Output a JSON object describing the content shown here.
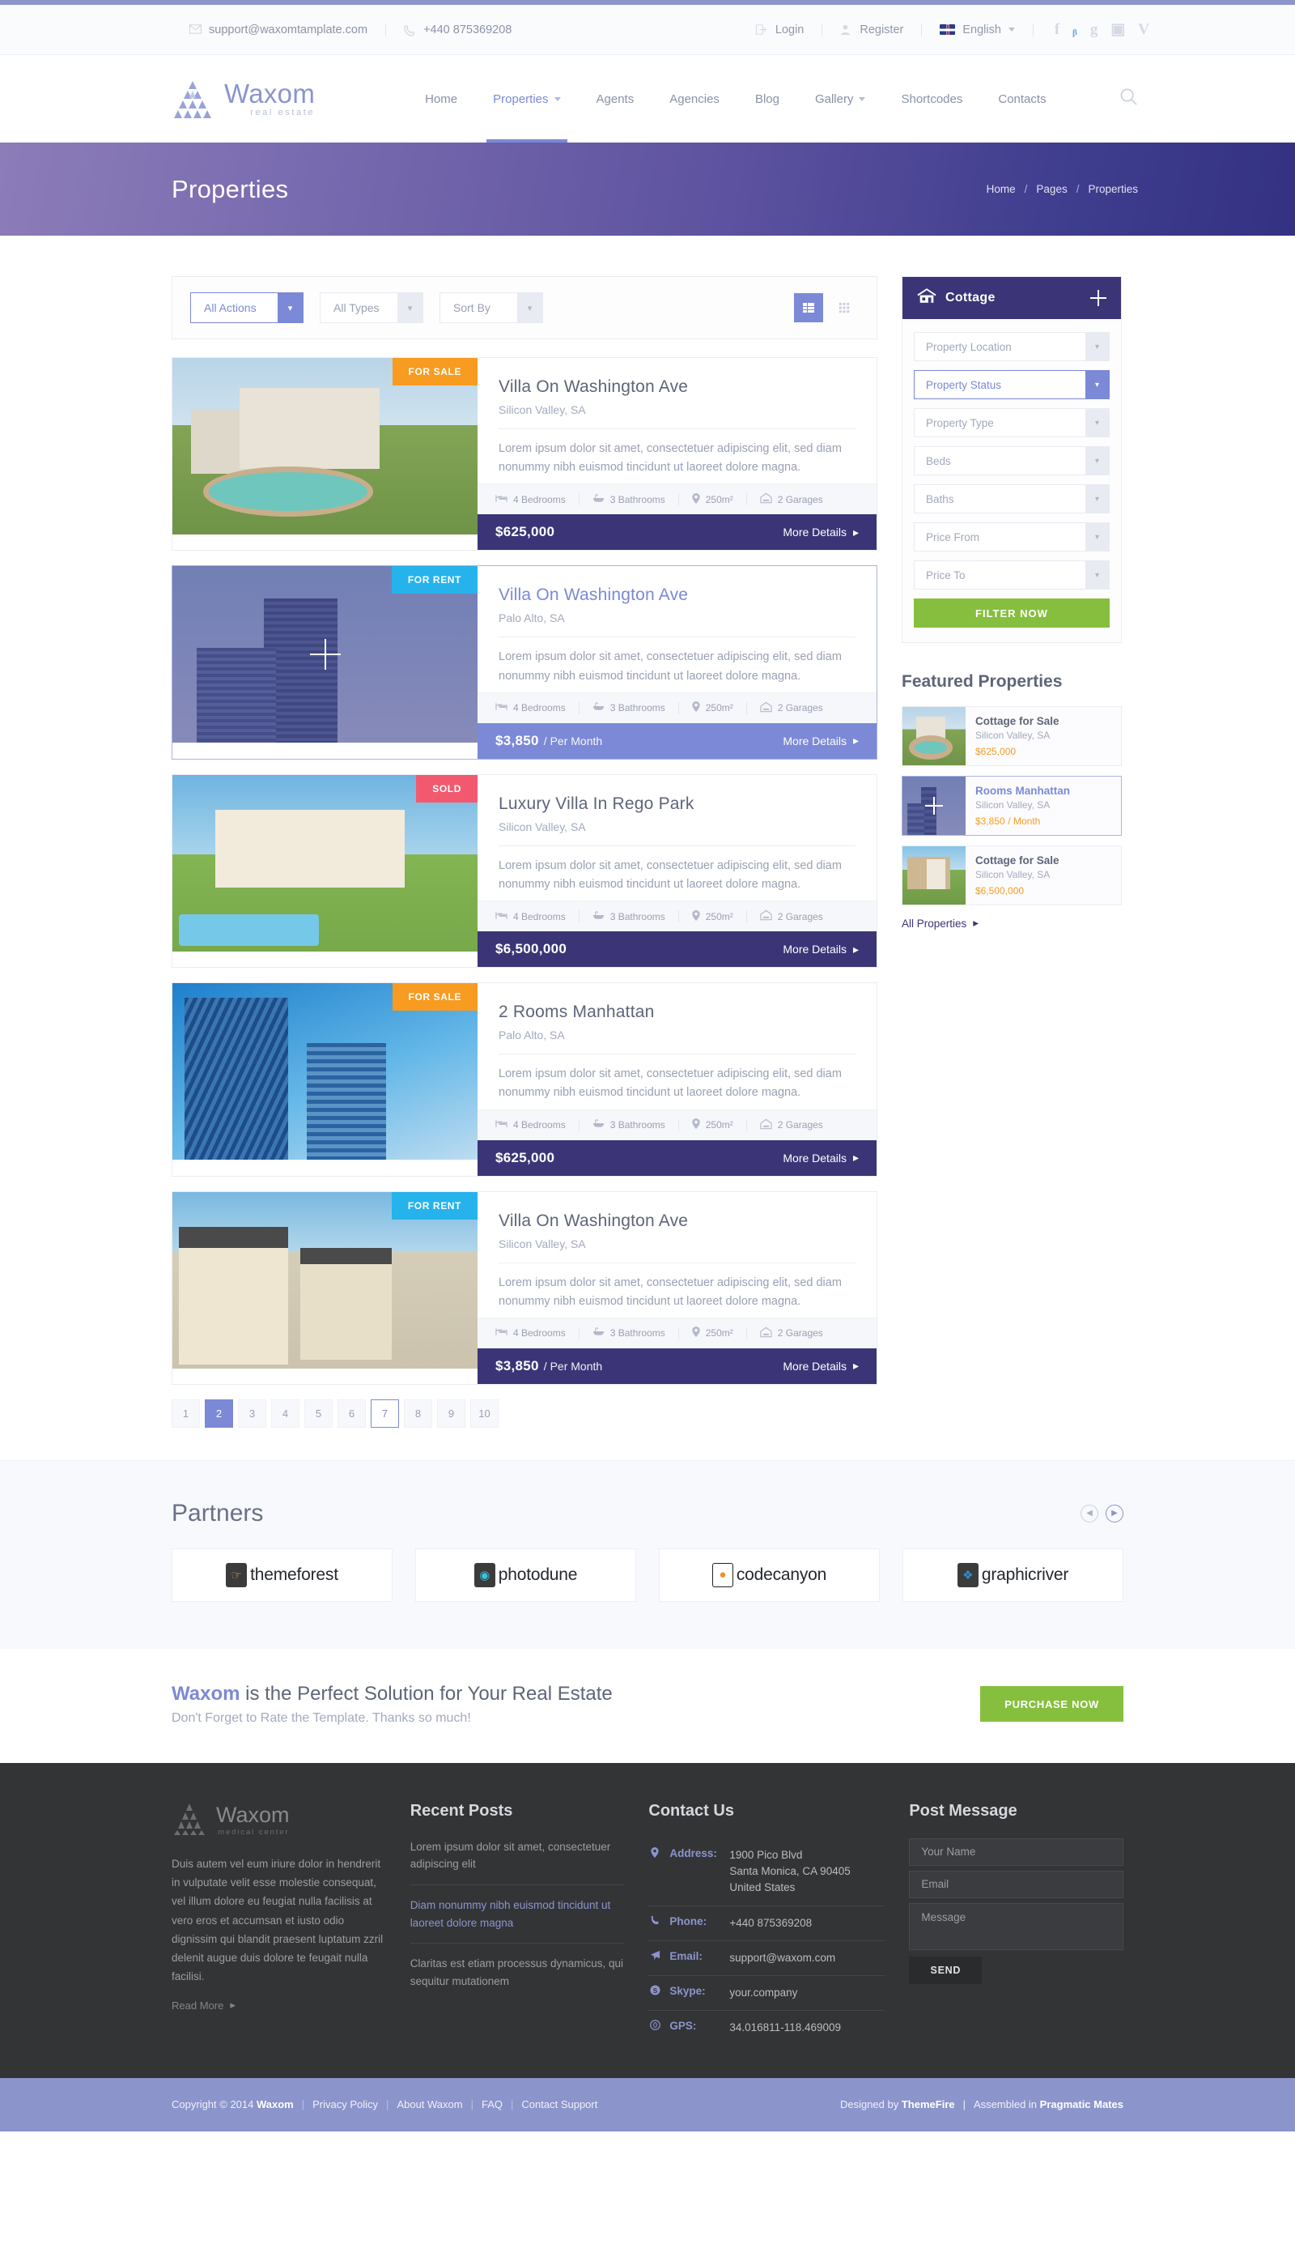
{
  "topbar": {
    "email": "support@waxomtamplate.com",
    "phone": "+440 875369208",
    "login": "Login",
    "register": "Register",
    "language": "English",
    "socials": [
      "f",
      "t",
      "g",
      "o",
      "v"
    ]
  },
  "header": {
    "logo_name": "Waxom",
    "logo_sub": "real estate",
    "nav": [
      {
        "label": "Home",
        "dropdown": false,
        "active": false
      },
      {
        "label": "Properties",
        "dropdown": true,
        "active": true
      },
      {
        "label": "Agents",
        "dropdown": false,
        "active": false
      },
      {
        "label": "Agencies",
        "dropdown": false,
        "active": false
      },
      {
        "label": "Blog",
        "dropdown": false,
        "active": false
      },
      {
        "label": "Gallery",
        "dropdown": true,
        "active": false
      },
      {
        "label": "Shortcodes",
        "dropdown": false,
        "active": false
      },
      {
        "label": "Contacts",
        "dropdown": false,
        "active": false
      }
    ]
  },
  "banner": {
    "title": "Properties",
    "breadcrumb": [
      "Home",
      "Pages",
      "Properties"
    ]
  },
  "filterbar": {
    "selects": [
      {
        "value": "All Actions",
        "active": true
      },
      {
        "value": "All Types",
        "active": false
      },
      {
        "value": "Sort By",
        "active": false
      }
    ],
    "view_list": "list-view",
    "view_grid": "grid-view"
  },
  "properties": [
    {
      "badge": "FOR SALE",
      "badge_type": "sale",
      "title": "Villa On Washington Ave",
      "location": "Silicon Valley, SA",
      "desc": "Lorem ipsum dolor sit amet, consectetuer adipiscing elit, sed diam nonummy nibh euismod tincidunt ut laoreet dolore magna.",
      "bedrooms": "4 Bedrooms",
      "bathrooms": "3 Bathrooms",
      "area": "250m²",
      "garages": "2 Garages",
      "price": "$625,000",
      "price_unit": "",
      "more": "More Details",
      "hover": false,
      "img": "img-villa"
    },
    {
      "badge": "FOR RENT",
      "badge_type": "rent",
      "title": "Villa On Washington Ave",
      "location": "Palo Alto, SA",
      "desc": "Lorem ipsum dolor sit amet, consectetuer adipiscing elit, sed diam nonummy nibh euismod tincidunt ut laoreet dolore magna.",
      "bedrooms": "4 Bedrooms",
      "bathrooms": "3 Bathrooms",
      "area": "250m²",
      "garages": "2 Garages",
      "price": "$3,850",
      "price_unit": "/ Per Month",
      "more": "More Details",
      "hover": true,
      "img": "img-tower"
    },
    {
      "badge": "SOLD",
      "badge_type": "sold",
      "title": "Luxury Villa In Rego Park",
      "location": "Silicon Valley, SA",
      "desc": "Lorem ipsum dolor sit amet, consectetuer adipiscing elit, sed diam nonummy nibh euismod tincidunt ut laoreet dolore magna.",
      "bedrooms": "4 Bedrooms",
      "bathrooms": "3 Bathrooms",
      "area": "250m²",
      "garages": "2 Garages",
      "price": "$6,500,000",
      "price_unit": "",
      "more": "More Details",
      "hover": false,
      "img": "img-lux"
    },
    {
      "badge": "FOR SALE",
      "badge_type": "sale",
      "title": "2 Rooms Manhattan",
      "location": "Palo Alto, SA",
      "desc": "Lorem ipsum dolor sit amet, consectetuer adipiscing elit, sed diam nonummy nibh euismod tincidunt ut laoreet dolore magna.",
      "bedrooms": "4 Bedrooms",
      "bathrooms": "3 Bathrooms",
      "area": "250m²",
      "garages": "2 Garages",
      "price": "$625,000",
      "price_unit": "",
      "more": "More Details",
      "hover": false,
      "img": "img-city"
    },
    {
      "badge": "FOR RENT",
      "badge_type": "rent",
      "title": "Villa On Washington Ave",
      "location": "Silicon Valley, SA",
      "desc": "Lorem ipsum dolor sit amet, consectetuer adipiscing elit, sed diam nonummy nibh euismod tincidunt ut laoreet dolore magna.",
      "bedrooms": "4 Bedrooms",
      "bathrooms": "3 Bathrooms",
      "area": "250m²",
      "garages": "2 Garages",
      "price": "$3,850",
      "price_unit": "/ Per Month",
      "more": "More Details",
      "hover": false,
      "img": "img-town"
    }
  ],
  "pagination": {
    "pages": [
      "1",
      "2",
      "3",
      "4",
      "5",
      "6",
      "7",
      "8",
      "9",
      "10"
    ],
    "active": "2",
    "hover": "7"
  },
  "sidebar": {
    "widget_title": "Cottage",
    "filters": [
      {
        "label": "Property Location",
        "active": false
      },
      {
        "label": "Property Status",
        "active": true
      },
      {
        "label": "Property Type",
        "active": false
      },
      {
        "label": "Beds",
        "active": false
      },
      {
        "label": "Baths",
        "active": false
      },
      {
        "label": "Price From",
        "active": false
      },
      {
        "label": "Price To",
        "active": false
      }
    ],
    "filter_button": "FILTER NOW",
    "featured_title": "Featured Properties",
    "featured": [
      {
        "name": "Cottage for Sale",
        "location": "Silicon Valley, SA",
        "price": "$625,000",
        "unit": "",
        "hover": false,
        "img": "img-villa"
      },
      {
        "name": "Rooms Manhattan",
        "location": "Silicon Valley, SA",
        "price": "$3,850",
        "unit": "/ Month",
        "hover": true,
        "img": "img-tower"
      },
      {
        "name": "Cottage for Sale",
        "location": "Silicon Valley, SA",
        "price": "$6,500,000",
        "unit": "",
        "hover": false,
        "img": "img-modern"
      }
    ],
    "all_properties": "All Properties"
  },
  "partners": {
    "title": "Partners",
    "logos": [
      {
        "name": "themeforest",
        "glyph": "☝",
        "color": "#3b3b3b"
      },
      {
        "name": "photodune",
        "glyph": "◉",
        "color": "#2aa8c4"
      },
      {
        "name": "codecanyon",
        "glyph": "◔",
        "color": "#f0f0f0"
      },
      {
        "name": "graphicriver",
        "glyph": "❈",
        "color": "#2f8fd0"
      }
    ]
  },
  "cta": {
    "brand": "Waxom",
    "headline": " is the Perfect Solution for Your Real Estate",
    "subline": "Don't Forget to Rate the Template. Thanks so much!",
    "button": "PURCHASE NOW"
  },
  "footer": {
    "logo_name": "Waxom",
    "logo_sub": "medical center",
    "about": "Duis autem vel eum iriure dolor in hendrerit in vulputate velit esse molestie consequat, vel illum dolore eu feugiat nulla facilisis at vero eros et accumsan et iusto odio dignissim qui blandit praesent luptatum zzril delenit augue duis dolore te feugait nulla facilisi.",
    "read_more": "Read More",
    "recent_posts_title": "Recent Posts",
    "posts": [
      {
        "text": "Lorem ipsum dolor sit amet, consectetuer adipiscing elit",
        "highlight": false
      },
      {
        "text": "Diam nonummy nibh euismod tincidunt ut laoreet dolore magna",
        "highlight": true
      },
      {
        "text": "Claritas est etiam processus dynamicus, qui sequitur mutationem",
        "highlight": false
      }
    ],
    "contact_title": "Contact Us",
    "contacts": [
      {
        "icon": "location-pin-icon",
        "glyph": "▼",
        "label": "Address:",
        "value": "1900 Pico Blvd\nSanta Monica, CA 90405\nUnited States"
      },
      {
        "icon": "phone-icon",
        "glyph": "✆",
        "label": "Phone:",
        "value": "+440 875369208"
      },
      {
        "icon": "paper-plane-icon",
        "glyph": "➤",
        "label": "Email:",
        "value": "support@waxom.com"
      },
      {
        "icon": "skype-icon",
        "glyph": "S",
        "label": "Skype:",
        "value": "your.company"
      },
      {
        "icon": "compass-icon",
        "glyph": "◎",
        "label": "GPS:",
        "value": "34.016811-118.469009"
      }
    ],
    "post_message_title": "Post Message",
    "form": {
      "name_placeholder": "Your Name",
      "email_placeholder": "Email",
      "message_placeholder": "Message",
      "send": "SEND"
    }
  },
  "bottombar": {
    "copyright": "Copyright © 2014",
    "copyright_brand": "Waxom",
    "links": [
      "Privacy Policy",
      "About Waxom",
      "FAQ",
      "Contact Support"
    ],
    "designed_by_label": "Designed by",
    "designed_by": "ThemeFire",
    "assembled_label": "Assembled in",
    "assembled_by": "Pragmatic Mates"
  },
  "colors": {
    "accent_blue": "#7b89d6",
    "dark_purple": "#3b3577",
    "orange": "#f79b21",
    "cyan": "#26b3ec",
    "red": "#f2596e",
    "green": "#86bf3e",
    "footer_bg": "#333436",
    "bottom_bar": "#8b95cc"
  }
}
